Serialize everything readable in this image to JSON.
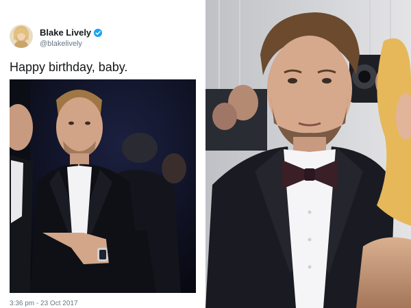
{
  "tweet": {
    "display_name": "Blake Lively",
    "handle": "@blakelively",
    "text": "Happy birthday, baby.",
    "timestamp": "3:36 pm - 23 Oct 2017",
    "verified_icon": "verified-badge-icon"
  },
  "colors": {
    "verified_blue": "#1da1f2",
    "text_dark": "#14171a",
    "text_muted": "#657786"
  }
}
